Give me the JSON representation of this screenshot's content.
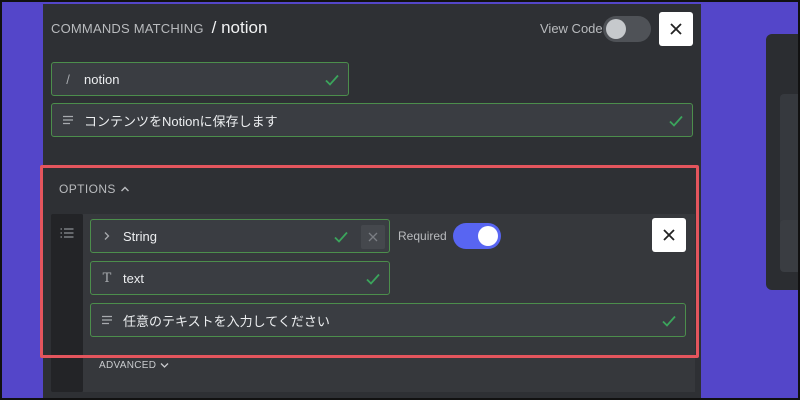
{
  "header": {
    "label": "COMMANDS MATCHING",
    "command": "/ notion",
    "view_code_label": "View Code",
    "view_code_enabled": false
  },
  "command": {
    "slash_prefix": "/",
    "name": "notion",
    "description": "コンテンツをNotionに保存します"
  },
  "options": {
    "label": "OPTIONS",
    "items": [
      {
        "type_value": "String",
        "name_prefix": "T",
        "name_value": "text",
        "description": "任意のテキストを入力してください",
        "required_label": "Required",
        "required": true
      }
    ],
    "advanced_label": "ADVANCED"
  },
  "colors": {
    "background": "#5446c9",
    "panel": "#2e3034",
    "accent": "#5865f2",
    "valid_border": "#4c8e4c",
    "check": "#3ba55c",
    "highlight": "#e4555d"
  }
}
